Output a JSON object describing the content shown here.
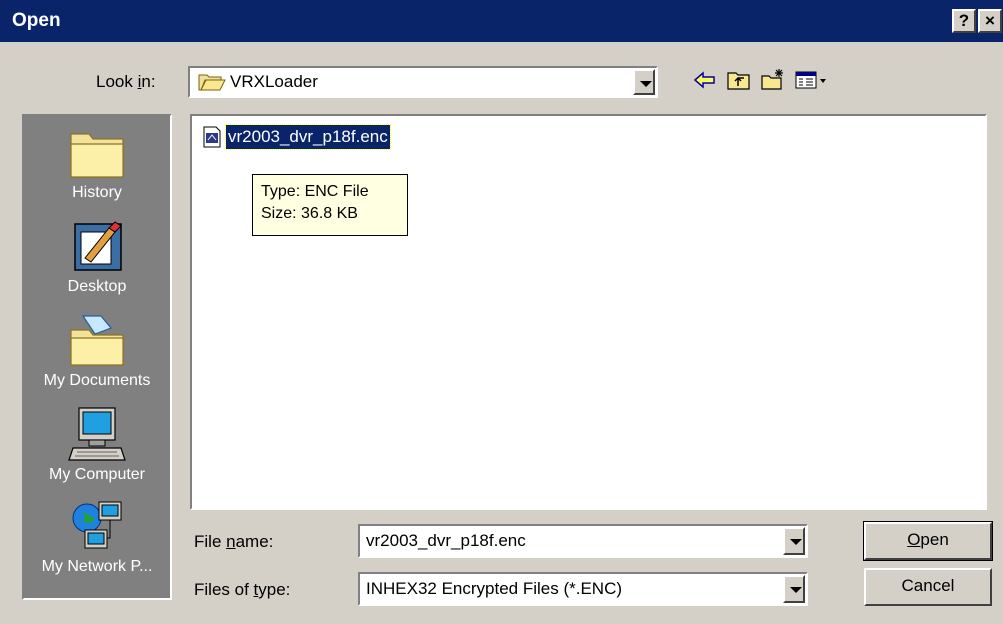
{
  "window": {
    "title": "Open",
    "help_button": "?",
    "close_button": "×"
  },
  "look_in": {
    "label_pre": "Look ",
    "label_accel": "i",
    "label_post": "n:",
    "value": "VRXLoader",
    "folder_icon": "folder-open-icon"
  },
  "toolbar": {
    "icons": [
      "back-arrow-icon",
      "up-folder-icon",
      "new-folder-icon",
      "view-menu-icon"
    ]
  },
  "places": [
    {
      "label": "History",
      "icon": "history-icon"
    },
    {
      "label": "Desktop",
      "icon": "desktop-icon"
    },
    {
      "label": "My Documents",
      "icon": "my-documents-icon"
    },
    {
      "label": "My Computer",
      "icon": "my-computer-icon"
    },
    {
      "label": "My Network P...",
      "icon": "network-places-icon"
    }
  ],
  "files": [
    {
      "name": "vr2003_dvr_p18f.enc",
      "selected": true
    }
  ],
  "tooltip": {
    "line1": "Type: ENC File",
    "line2": "Size: 36.8 KB"
  },
  "file_name": {
    "label_pre": "File ",
    "label_accel": "n",
    "label_post": "ame:",
    "value": "vr2003_dvr_p18f.enc"
  },
  "file_type": {
    "label_pre": "Files of ",
    "label_accel": "t",
    "label_post": "ype:",
    "value": "INHEX32 Encrypted Files (*.ENC)"
  },
  "buttons": {
    "open_accel": "O",
    "open_rest": "pen",
    "cancel": "Cancel"
  },
  "colors": {
    "titlebar": "#0a246a",
    "face": "#d4d0c8",
    "places_bg": "#808080",
    "tooltip_bg": "#ffffe1"
  }
}
